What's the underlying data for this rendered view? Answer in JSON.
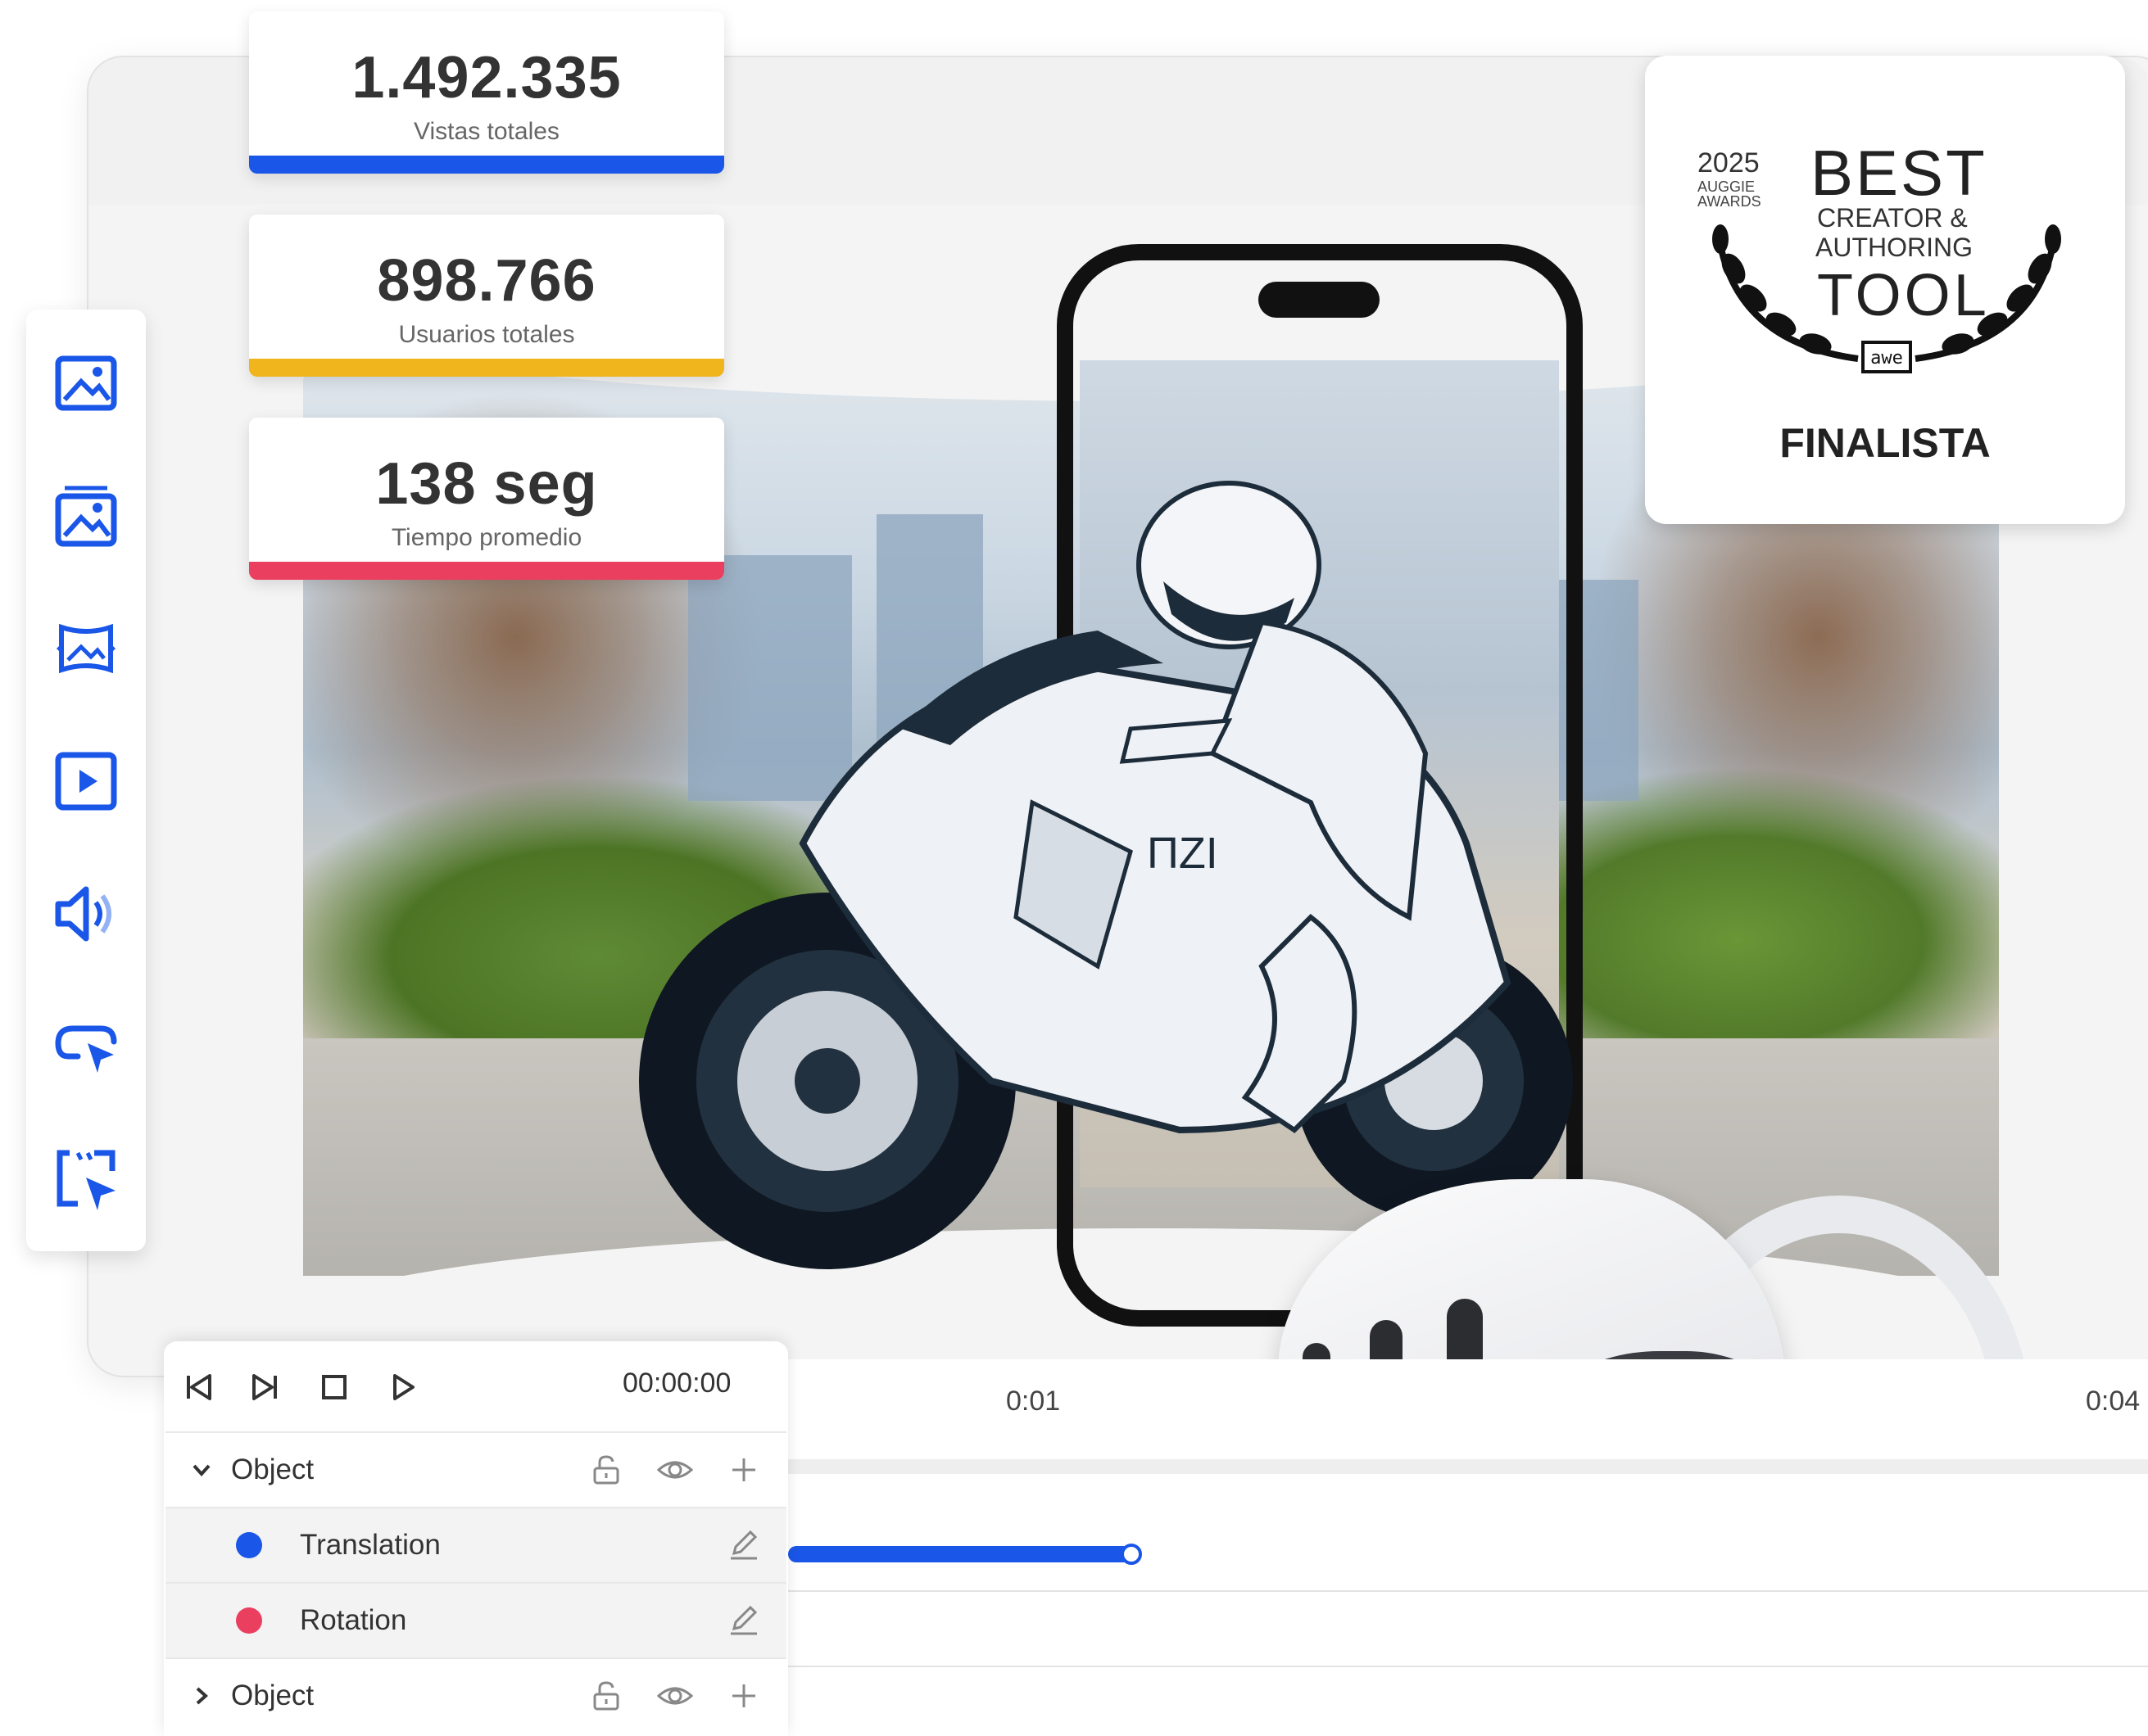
{
  "stats": [
    {
      "value": "1.492.335",
      "label": "Vistas totales",
      "color": "#1a56e8"
    },
    {
      "value": "898.766",
      "label": "Usuarios totales",
      "color": "#f0b41c"
    },
    {
      "value": "138 seg",
      "label": "Tiempo promedio",
      "color": "#ea3f5f"
    }
  ],
  "award": {
    "year": "2025",
    "program_line1": "AUGGIE",
    "program_line2": "AWARDS",
    "best": "BEST",
    "line1": "CREATOR &",
    "line2": "AUTHORING",
    "tool": "TOOL",
    "status": "FINALISTA",
    "logo_text": "awe"
  },
  "tools": [
    "image-icon",
    "image-stack-icon",
    "panorama-icon",
    "video-icon",
    "audio-icon",
    "hotspot-icon",
    "area-select-icon"
  ],
  "timeline": {
    "timecode": "00:00:00",
    "ruler": [
      "0:01",
      "0:04"
    ],
    "tracks": {
      "object1": {
        "label": "Object"
      },
      "translation": {
        "label": "Translation",
        "color": "#1a56e8"
      },
      "rotation": {
        "label": "Rotation",
        "color": "#ea3f5f"
      },
      "object2": {
        "label": "Object"
      }
    }
  },
  "colors": {
    "accent": "#1a56e8",
    "toolIcon": "#1a56e8"
  }
}
